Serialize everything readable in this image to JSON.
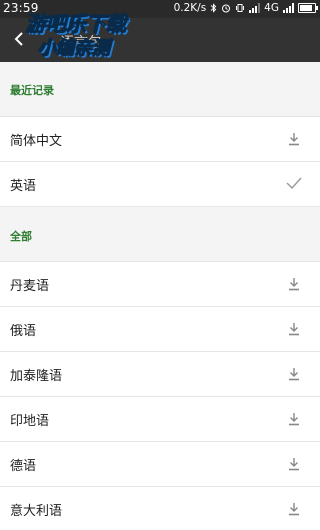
{
  "status_bar": {
    "time": "23:59",
    "speed": "0.2K/s",
    "network": "4G",
    "battery_level": 0.85
  },
  "watermark": {
    "line1": "游吧乐下载",
    "line2": "小编亲测"
  },
  "app_bar": {
    "title": "语言包"
  },
  "sections": {
    "recent_header": "最近记录",
    "all_header": "全部"
  },
  "recent_items": [
    {
      "label": "简体中文",
      "action_icon": "download-icon"
    },
    {
      "label": "英语",
      "action_icon": "check-icon"
    }
  ],
  "all_items": [
    {
      "label": "丹麦语",
      "action_icon": "download-icon"
    },
    {
      "label": "俄语",
      "action_icon": "download-icon"
    },
    {
      "label": "加泰隆语",
      "action_icon": "download-icon"
    },
    {
      "label": "印地语",
      "action_icon": "download-icon"
    },
    {
      "label": "德语",
      "action_icon": "download-icon"
    },
    {
      "label": "意大利语",
      "action_icon": "download-icon"
    }
  ],
  "colors": {
    "accent_green": "#2e7d32",
    "app_bar": "#333333",
    "status_bar": "#2a2a2a",
    "icon_gray": "#888888"
  }
}
